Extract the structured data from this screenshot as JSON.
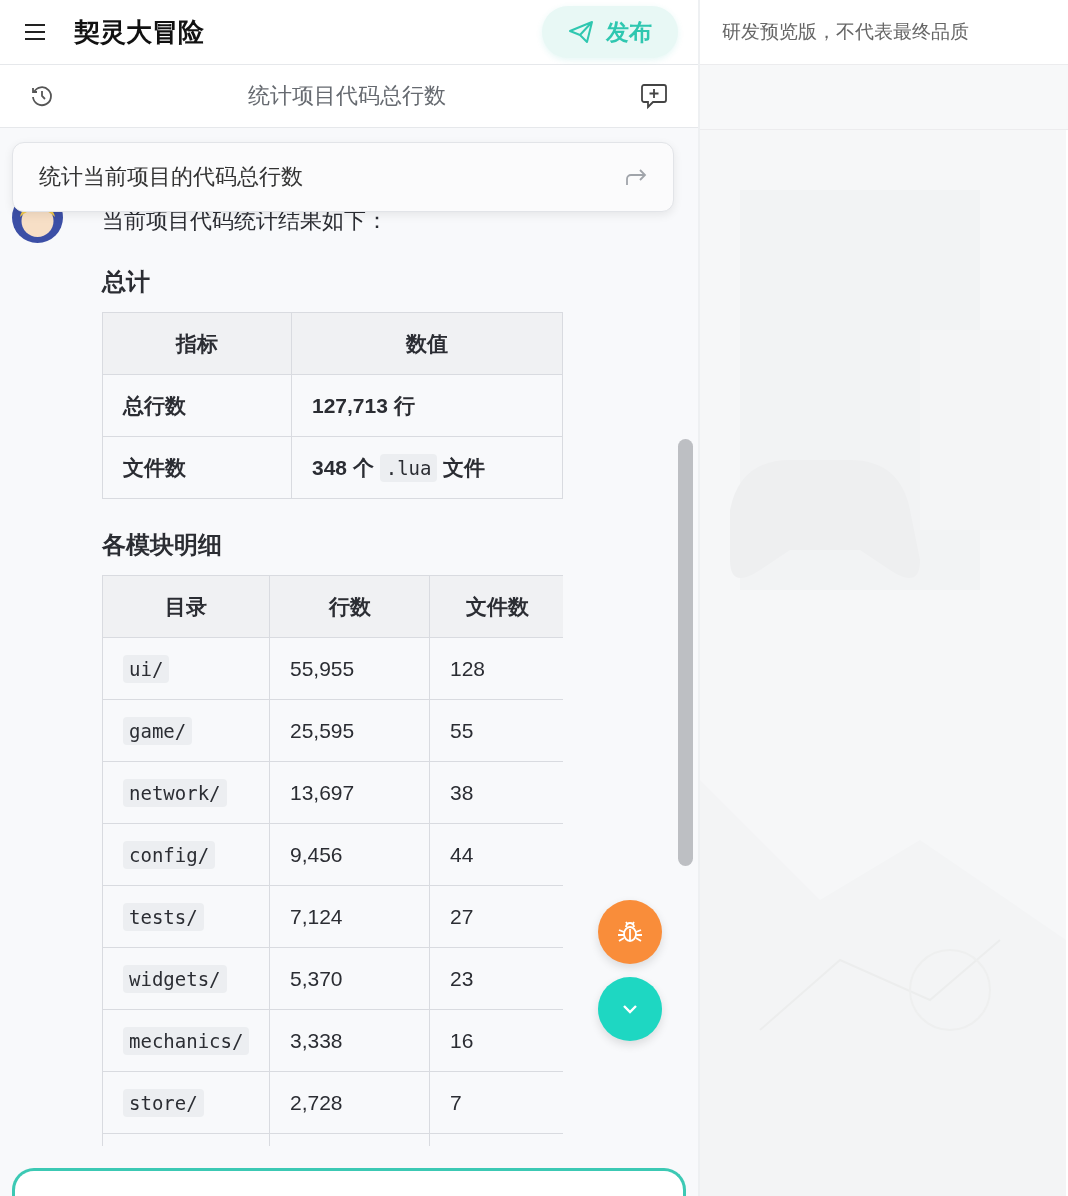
{
  "header": {
    "title": "契灵大冒险",
    "publish_button": "发布"
  },
  "notice": "研发预览版，不代表最终品质",
  "conversation": {
    "title": "统计项目代码总行数"
  },
  "prompt_card": {
    "text": "统计当前项目的代码总行数"
  },
  "reply": {
    "intro": "当前项目代码统计结果如下：",
    "sections": [
      {
        "heading": "总计",
        "strong": true,
        "table": {
          "columns": [
            "指标",
            "数值"
          ],
          "rows": [
            [
              [
                {
                  "kind": "text",
                  "text": "总行数"
                }
              ],
              [
                {
                  "kind": "text",
                  "text": "127,713 行"
                }
              ]
            ],
            [
              [
                {
                  "kind": "text",
                  "text": "文件数"
                }
              ],
              [
                {
                  "kind": "text",
                  "text": "348 个 "
                },
                {
                  "kind": "code",
                  "text": ".lua"
                },
                {
                  "kind": "text",
                  "text": " 文件"
                }
              ]
            ]
          ]
        }
      },
      {
        "heading": "各模块明细",
        "strong": false,
        "table": {
          "columns": [
            "目录",
            "行数",
            "文件数"
          ],
          "rows": [
            [
              [
                {
                  "kind": "code",
                  "text": "ui/"
                }
              ],
              [
                {
                  "kind": "text",
                  "text": "55,955"
                }
              ],
              [
                {
                  "kind": "text",
                  "text": "128"
                }
              ]
            ],
            [
              [
                {
                  "kind": "code",
                  "text": "game/"
                }
              ],
              [
                {
                  "kind": "text",
                  "text": "25,595"
                }
              ],
              [
                {
                  "kind": "text",
                  "text": "55"
                }
              ]
            ],
            [
              [
                {
                  "kind": "code",
                  "text": "network/"
                }
              ],
              [
                {
                  "kind": "text",
                  "text": "13,697"
                }
              ],
              [
                {
                  "kind": "text",
                  "text": "38"
                }
              ]
            ],
            [
              [
                {
                  "kind": "code",
                  "text": "config/"
                }
              ],
              [
                {
                  "kind": "text",
                  "text": "9,456"
                }
              ],
              [
                {
                  "kind": "text",
                  "text": "44"
                }
              ]
            ],
            [
              [
                {
                  "kind": "code",
                  "text": "tests/"
                }
              ],
              [
                {
                  "kind": "text",
                  "text": "7,124"
                }
              ],
              [
                {
                  "kind": "text",
                  "text": "27"
                }
              ]
            ],
            [
              [
                {
                  "kind": "code",
                  "text": "widgets/"
                }
              ],
              [
                {
                  "kind": "text",
                  "text": "5,370"
                }
              ],
              [
                {
                  "kind": "text",
                  "text": "23"
                }
              ]
            ],
            [
              [
                {
                  "kind": "code",
                  "text": "mechanics/"
                }
              ],
              [
                {
                  "kind": "text",
                  "text": "3,338"
                }
              ],
              [
                {
                  "kind": "text",
                  "text": "16"
                }
              ]
            ],
            [
              [
                {
                  "kind": "code",
                  "text": "store/"
                }
              ],
              [
                {
                  "kind": "text",
                  "text": "2,728"
                }
              ],
              [
                {
                  "kind": "text",
                  "text": "7"
                }
              ]
            ]
          ]
        }
      }
    ]
  }
}
